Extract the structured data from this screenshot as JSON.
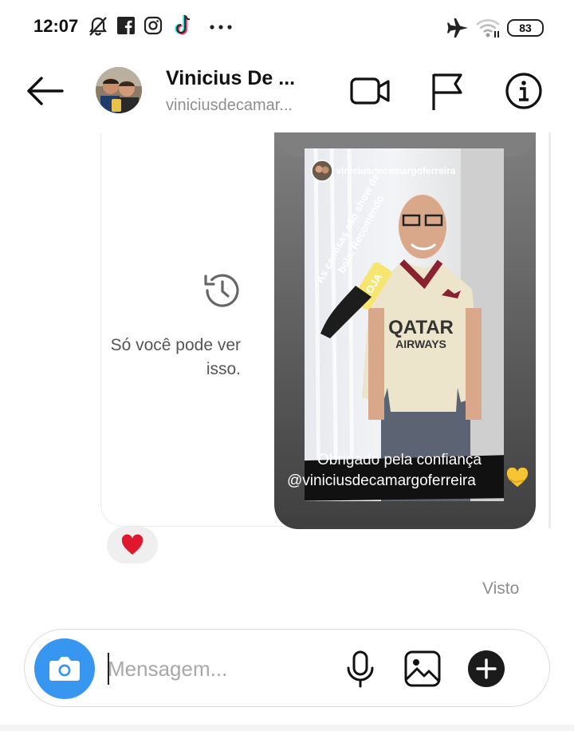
{
  "status_bar": {
    "time": "12:07",
    "battery": "83",
    "icons": [
      "mute-bell-icon",
      "facebook-icon",
      "instagram-icon",
      "tiktok-icon",
      "more-dots-icon",
      "airplane-icon",
      "wifi-icon"
    ]
  },
  "header": {
    "name": "Vinicius De ...",
    "username": "viniciusdecamar...",
    "icons": [
      "back-arrow-icon",
      "video-call-icon",
      "flag-icon",
      "info-icon"
    ]
  },
  "messages": {
    "hidden_notice": "Só você pode ver isso.",
    "story": {
      "username": "viniciusdecamargoferreira",
      "vertical_caption_line1": "As camisas são show de",
      "vertical_caption_line2": "bola. Recomendo",
      "sticker_text": "LOJA",
      "caption_line1": "Obrigado pela confiança",
      "caption_line2": "@viniciusdecamargoferreira",
      "shirt_text_1": "QATAR",
      "shirt_text_2": "AIRWAYS"
    },
    "reaction": "❤",
    "seen_label": "Visto"
  },
  "composer": {
    "placeholder": "Mensagem...",
    "icons": [
      "camera-icon",
      "microphone-icon",
      "gallery-icon",
      "add-icon"
    ]
  },
  "colors": {
    "accent": "#3797f0",
    "muted": "#8e8e8e",
    "heart": "#e0182d"
  }
}
